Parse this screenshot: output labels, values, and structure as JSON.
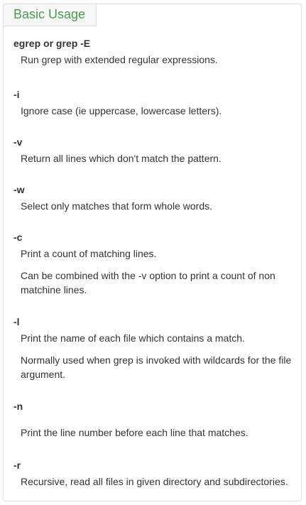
{
  "panel": {
    "tab_label": "Basic Usage"
  },
  "options": [
    {
      "name": "egrep or grep -E",
      "desc": [
        "Run grep with extended regular expressions."
      ]
    },
    {
      "name": "-i",
      "desc": [
        "Ignore case (ie uppercase, lowercase letters)."
      ]
    },
    {
      "name": "-v",
      "desc": [
        "Return all lines which don't match the pattern."
      ]
    },
    {
      "name": "-w",
      "desc": [
        "Select only matches that form whole words."
      ]
    },
    {
      "name": "-c",
      "desc": [
        "Print a count of matching lines.",
        "Can be combined with the -v option to print a count of non matchine lines."
      ]
    },
    {
      "name": "-l",
      "desc": [
        "Print the name of each file which contains a match.",
        "Normally used when grep is invoked with wildcards for the file argument."
      ]
    },
    {
      "name": "-n",
      "desc": [
        "Print the line number before each line that matches."
      ]
    },
    {
      "name": "-r",
      "desc": [
        "Recursive, read all files in given directory and subdirectories."
      ]
    }
  ]
}
